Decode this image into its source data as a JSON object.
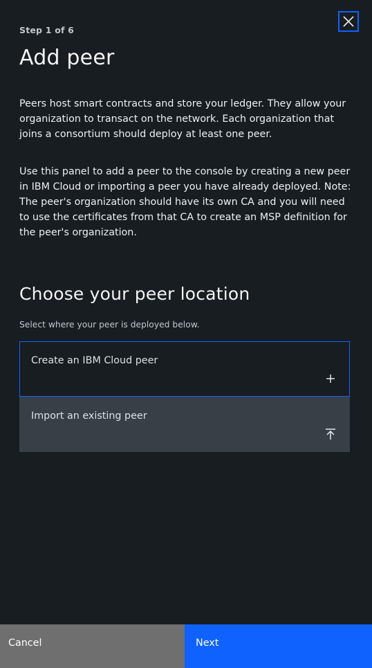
{
  "header": {
    "step": "Step 1 of 6",
    "title": "Add peer"
  },
  "intro": {
    "paragraph1": "Peers host smart contracts and store your ledger. They allow your organization to transact on the network. Each organization that joins a consortium should deploy at least one peer.",
    "paragraph2": "Use this panel to add a peer to the console by creating a new peer in IBM Cloud or importing a peer you have already deployed. Note: The peer's organization should have its own CA and you will need to use the certificates from that CA to create an MSP definition for the peer's organization."
  },
  "location": {
    "title": "Choose your peer location",
    "help": "Select where your peer is deployed below.",
    "options": [
      {
        "label": "Create an IBM Cloud peer",
        "icon": "plus-icon"
      },
      {
        "label": "Import an existing peer",
        "icon": "upload-icon"
      }
    ]
  },
  "footer": {
    "cancel_label": "Cancel",
    "next_label": "Next"
  },
  "icons": {
    "close": "close-icon"
  },
  "colors": {
    "background": "#171d21",
    "accent": "#0f62fe",
    "secondary_button": "#6f6f6f",
    "tile_background": "#393f46"
  }
}
